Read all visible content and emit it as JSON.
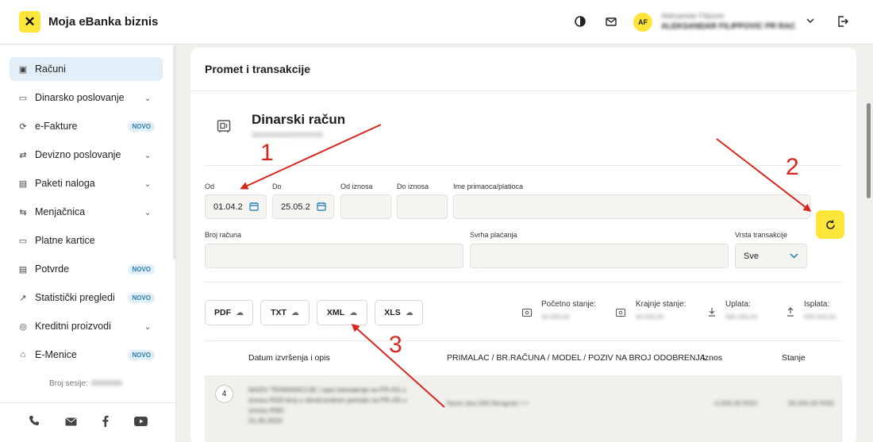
{
  "header": {
    "logo_glyph": "✕",
    "app_title": "Moja eBanka biznis",
    "contrast_icon": "contrast-icon",
    "mail_icon": "mail-icon",
    "avatar_initials": "AF",
    "user_name": "Aleksandar Filipovic",
    "user_company": "ALEKSANDAR FILIPPOVIĆ PR RAČ…",
    "chevron": "⌄",
    "logout_icon": "logout-icon"
  },
  "sidebar": {
    "items": [
      {
        "label": "Računi",
        "icon": "▣",
        "active": true
      },
      {
        "label": "Dinarsko poslovanje",
        "icon": "▭",
        "chevron": "⌄"
      },
      {
        "label": "e-Fakture",
        "icon": "⟳",
        "badge": "NOVO"
      },
      {
        "label": "Devizno poslovanje",
        "icon": "⇄",
        "chevron": "⌄"
      },
      {
        "label": "Paketi naloga",
        "icon": "▤",
        "chevron": "⌄"
      },
      {
        "label": "Menjačnica",
        "icon": "⇆",
        "chevron": "⌄"
      },
      {
        "label": "Platne kartice",
        "icon": "▭"
      },
      {
        "label": "Potvrde",
        "icon": "▤",
        "badge": "NOVO"
      },
      {
        "label": "Statistički pregledi",
        "icon": "↗",
        "badge": "NOVO"
      },
      {
        "label": "Kreditni proizvodi",
        "icon": "◎",
        "chevron": "⌄"
      },
      {
        "label": "E-Menice",
        "icon": "⌂",
        "badge": "NOVO"
      }
    ],
    "session_label": "Broj sesije:",
    "session_value": "0000000",
    "footer_icons": [
      "phone-icon",
      "mail-icon",
      "facebook-icon",
      "youtube-icon"
    ]
  },
  "main": {
    "title": "Promet i transakcije",
    "account": {
      "title": "Dinarski račun",
      "number": "265000000000000000"
    },
    "filters": {
      "od_label": "Od",
      "od_value": "01.04.2",
      "do_label": "Do",
      "do_value": "25.05.2",
      "od_iznosa_label": "Od iznosa",
      "do_iznosa_label": "Do iznosa",
      "ime_label": "Ime primaoca/platioca",
      "broj_racuna_label": "Broj računa",
      "svrha_label": "Svrha plaćanja",
      "vrsta_label": "Vrsta transakcije",
      "vrsta_value": "Sve"
    },
    "downloads": [
      "PDF",
      "TXT",
      "XML",
      "XLS"
    ],
    "balances": {
      "pocetno_label": "Početno stanje:",
      "pocetno_value": "00.000,00",
      "krajnje_label": "Krajnje stanje:",
      "krajnje_value": "00.000,00",
      "uplata_label": "Uplata:",
      "uplata_value": "000.000,00",
      "isplata_label": "Isplata:",
      "isplata_value": "000.000,00"
    },
    "table": {
      "headers": [
        "Datum izvršenja i opis",
        "PRIMALAC / BR.RAČUNA / MODEL / POZIV NA BROJ ODOBRENJA",
        "Iznos",
        "Stanje"
      ],
      "rows": [
        {
          "num": "4",
          "description": "NAZIV TRANSAKCIJE / opis transakcije sa PR-AS u iznosu RSD broj u obračunskom periodu sa PR-AS u iznosu RSD",
          "date": "01.05.2024",
          "receiver": "Naziv doo 000 Beograd / / /",
          "amount": "-0.000,00 RSD",
          "balance": "00.000,00 RSD"
        }
      ]
    }
  },
  "annotations": {
    "arrow_color": "#d9261c",
    "labels": [
      "1",
      "2",
      "3"
    ]
  },
  "colors": {
    "brand_yellow": "#fee539",
    "accent_blue": "#1d79b8",
    "badge_bg": "#e1f0f8",
    "badge_text": "#2f7fb0",
    "active_nav": "#e3eff8"
  }
}
